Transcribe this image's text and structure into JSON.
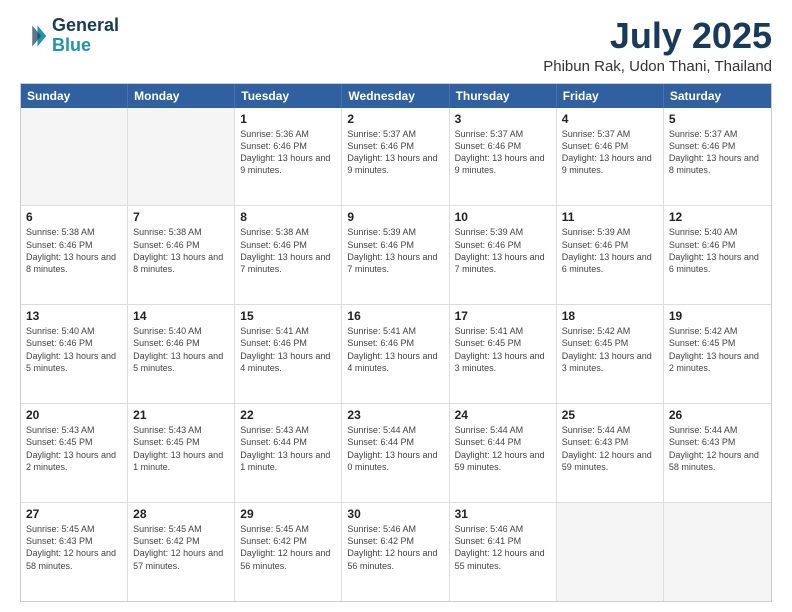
{
  "logo": {
    "line1": "General",
    "line2": "Blue"
  },
  "title": "July 2025",
  "subtitle": "Phibun Rak, Udon Thani, Thailand",
  "header_days": [
    "Sunday",
    "Monday",
    "Tuesday",
    "Wednesday",
    "Thursday",
    "Friday",
    "Saturday"
  ],
  "weeks": [
    [
      {
        "day": "",
        "text": ""
      },
      {
        "day": "",
        "text": ""
      },
      {
        "day": "1",
        "text": "Sunrise: 5:36 AM\nSunset: 6:46 PM\nDaylight: 13 hours and 9 minutes."
      },
      {
        "day": "2",
        "text": "Sunrise: 5:37 AM\nSunset: 6:46 PM\nDaylight: 13 hours and 9 minutes."
      },
      {
        "day": "3",
        "text": "Sunrise: 5:37 AM\nSunset: 6:46 PM\nDaylight: 13 hours and 9 minutes."
      },
      {
        "day": "4",
        "text": "Sunrise: 5:37 AM\nSunset: 6:46 PM\nDaylight: 13 hours and 9 minutes."
      },
      {
        "day": "5",
        "text": "Sunrise: 5:37 AM\nSunset: 6:46 PM\nDaylight: 13 hours and 8 minutes."
      }
    ],
    [
      {
        "day": "6",
        "text": "Sunrise: 5:38 AM\nSunset: 6:46 PM\nDaylight: 13 hours and 8 minutes."
      },
      {
        "day": "7",
        "text": "Sunrise: 5:38 AM\nSunset: 6:46 PM\nDaylight: 13 hours and 8 minutes."
      },
      {
        "day": "8",
        "text": "Sunrise: 5:38 AM\nSunset: 6:46 PM\nDaylight: 13 hours and 7 minutes."
      },
      {
        "day": "9",
        "text": "Sunrise: 5:39 AM\nSunset: 6:46 PM\nDaylight: 13 hours and 7 minutes."
      },
      {
        "day": "10",
        "text": "Sunrise: 5:39 AM\nSunset: 6:46 PM\nDaylight: 13 hours and 7 minutes."
      },
      {
        "day": "11",
        "text": "Sunrise: 5:39 AM\nSunset: 6:46 PM\nDaylight: 13 hours and 6 minutes."
      },
      {
        "day": "12",
        "text": "Sunrise: 5:40 AM\nSunset: 6:46 PM\nDaylight: 13 hours and 6 minutes."
      }
    ],
    [
      {
        "day": "13",
        "text": "Sunrise: 5:40 AM\nSunset: 6:46 PM\nDaylight: 13 hours and 5 minutes."
      },
      {
        "day": "14",
        "text": "Sunrise: 5:40 AM\nSunset: 6:46 PM\nDaylight: 13 hours and 5 minutes."
      },
      {
        "day": "15",
        "text": "Sunrise: 5:41 AM\nSunset: 6:46 PM\nDaylight: 13 hours and 4 minutes."
      },
      {
        "day": "16",
        "text": "Sunrise: 5:41 AM\nSunset: 6:46 PM\nDaylight: 13 hours and 4 minutes."
      },
      {
        "day": "17",
        "text": "Sunrise: 5:41 AM\nSunset: 6:45 PM\nDaylight: 13 hours and 3 minutes."
      },
      {
        "day": "18",
        "text": "Sunrise: 5:42 AM\nSunset: 6:45 PM\nDaylight: 13 hours and 3 minutes."
      },
      {
        "day": "19",
        "text": "Sunrise: 5:42 AM\nSunset: 6:45 PM\nDaylight: 13 hours and 2 minutes."
      }
    ],
    [
      {
        "day": "20",
        "text": "Sunrise: 5:43 AM\nSunset: 6:45 PM\nDaylight: 13 hours and 2 minutes."
      },
      {
        "day": "21",
        "text": "Sunrise: 5:43 AM\nSunset: 6:45 PM\nDaylight: 13 hours and 1 minute."
      },
      {
        "day": "22",
        "text": "Sunrise: 5:43 AM\nSunset: 6:44 PM\nDaylight: 13 hours and 1 minute."
      },
      {
        "day": "23",
        "text": "Sunrise: 5:44 AM\nSunset: 6:44 PM\nDaylight: 13 hours and 0 minutes."
      },
      {
        "day": "24",
        "text": "Sunrise: 5:44 AM\nSunset: 6:44 PM\nDaylight: 12 hours and 59 minutes."
      },
      {
        "day": "25",
        "text": "Sunrise: 5:44 AM\nSunset: 6:43 PM\nDaylight: 12 hours and 59 minutes."
      },
      {
        "day": "26",
        "text": "Sunrise: 5:44 AM\nSunset: 6:43 PM\nDaylight: 12 hours and 58 minutes."
      }
    ],
    [
      {
        "day": "27",
        "text": "Sunrise: 5:45 AM\nSunset: 6:43 PM\nDaylight: 12 hours and 58 minutes."
      },
      {
        "day": "28",
        "text": "Sunrise: 5:45 AM\nSunset: 6:42 PM\nDaylight: 12 hours and 57 minutes."
      },
      {
        "day": "29",
        "text": "Sunrise: 5:45 AM\nSunset: 6:42 PM\nDaylight: 12 hours and 56 minutes."
      },
      {
        "day": "30",
        "text": "Sunrise: 5:46 AM\nSunset: 6:42 PM\nDaylight: 12 hours and 56 minutes."
      },
      {
        "day": "31",
        "text": "Sunrise: 5:46 AM\nSunset: 6:41 PM\nDaylight: 12 hours and 55 minutes."
      },
      {
        "day": "",
        "text": ""
      },
      {
        "day": "",
        "text": ""
      }
    ]
  ]
}
